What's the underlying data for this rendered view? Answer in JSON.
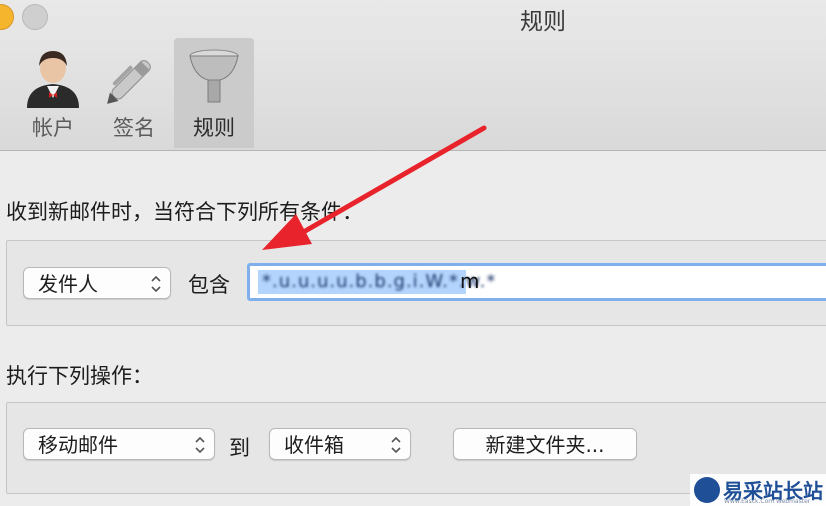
{
  "window": {
    "title": "规则"
  },
  "toolbar": {
    "tabs": [
      {
        "label": "帐户",
        "icon": "person-icon"
      },
      {
        "label": "签名",
        "icon": "pen-icon"
      },
      {
        "label": "规则",
        "icon": "funnel-icon",
        "active": true
      }
    ]
  },
  "conditions": {
    "heading": "收到新邮件时，当符合下列所有条件：",
    "field_select": "发件人",
    "operator_label": "包含",
    "value_visible_tail": "m",
    "value_obscured": "*.u.u.u.u.b.b.g.i.W.*.w.*"
  },
  "actions": {
    "heading": "执行下列操作：",
    "action_select": "移动邮件",
    "to_label": "到",
    "mailbox_select": "收件箱",
    "new_folder_button": "新建文件夹..."
  },
  "watermark": {
    "text": "易采站长站",
    "subtext": "Www.Easck.Com Webmaster"
  },
  "colors": {
    "arrow": "#e8232b",
    "focus_ring": "#7fb0ec",
    "selection": "#b3d4fc"
  }
}
